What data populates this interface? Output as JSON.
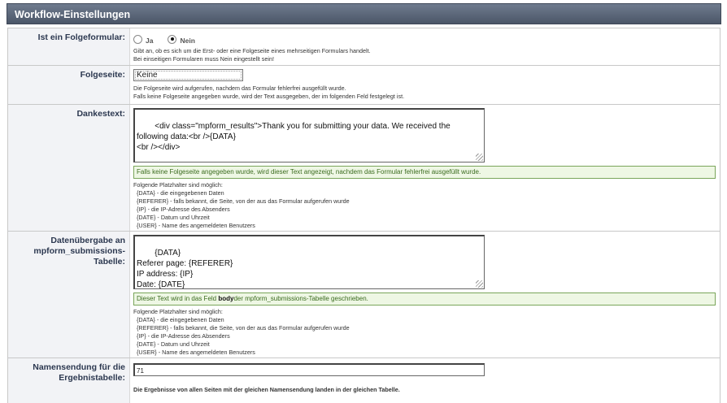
{
  "header": {
    "title": "Workflow-Einstellungen"
  },
  "folgeformular": {
    "label": "Ist ein Folgeformular:",
    "options": [
      "Ja",
      "Nein"
    ],
    "selected": "Nein",
    "help": [
      "Gibt an, ob es sich um die Erst- oder eine Folgeseite eines mehrseitigen Formulars handelt.",
      "Bei einseitigen Formularen muss Nein eingestellt sein!"
    ]
  },
  "folgeseite": {
    "label": "Folgeseite:",
    "value": "Keine",
    "help": [
      "Die Folgeseite wird aufgerufen, nachdem das Formular fehlerfrei ausgefüllt wurde.",
      "Falls keine Folgeseite angegeben wurde, wird der Text ausgegeben, der im folgenden Feld festgelegt ist."
    ]
  },
  "dankestext": {
    "label": "Dankestext:",
    "value": "<div class=\"mpform_results\">Thank you for submitting your data. We received the following data:<br />{DATA}\n<br /></div>",
    "note": "Falls keine Folgeseite angegeben wurde, wird dieser Text angezeigt, nachdem das Formular fehlerfrei ausgefüllt wurde.",
    "help_title": "Folgende Platzhalter sind möglich:",
    "placeholders": [
      "{DATA} - die eingegebenen Daten",
      "{REFERER} - falls bekannt, die Seite, von der aus das Formular aufgerufen wurde",
      "{IP} - die IP-Adresse des Absenders",
      "{DATE} - Datum und Uhrzeit",
      "{USER} - Name des angemeldeten Benutzers"
    ]
  },
  "datenuebergabe": {
    "label_lines": [
      "Datenübergabe an",
      "mpform_submissions-",
      "Tabelle:"
    ],
    "value": "{DATA}\nReferer page: {REFERER}\nIP address: {IP}\nDate: {DATE}",
    "note_before": "Dieser Text wird in das Feld ",
    "note_bold": "body",
    "note_after": "der mpform_submissions-Tabelle geschrieben.",
    "help_title": "Folgende Platzhalter sind möglich:",
    "placeholders": [
      "{DATA} - die eingegebenen Daten",
      "{REFERER} - falls bekannt, die Seite, von der aus das Formular aufgerufen wurde",
      "{IP} - die IP-Adresse des Absenders",
      "{DATE} - Datum und Uhrzeit",
      "{USER} - Name des angemeldeten Benutzers"
    ]
  },
  "namensendung": {
    "label_lines": [
      "Namensendung für die",
      "Ergebnistabelle:"
    ],
    "value": "71",
    "help": "Die Ergebnisse von allen Seiten mit der gleichen Namensendung landen in der gleichen Tabelle."
  }
}
